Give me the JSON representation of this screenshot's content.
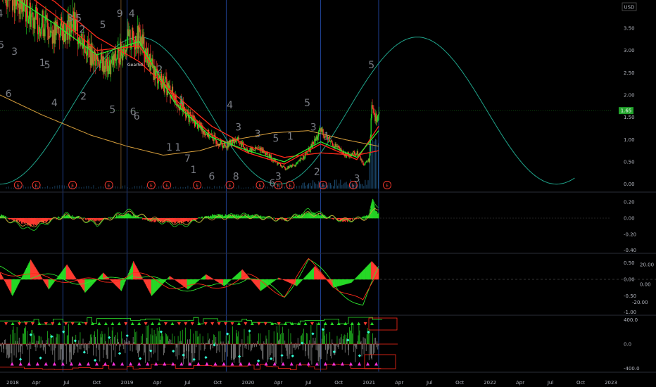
{
  "currency_label": "USD",
  "last_price_label": "1.65",
  "annotation_label": "Gearhd",
  "colors": {
    "background": "#000000",
    "up": "#26d926",
    "down": "#ff3b30",
    "sine": "#1fa38a",
    "ma_orange": "#d9a03c",
    "ma_red": "#ff2a1a",
    "ma_green": "#2ee82e",
    "earnings": "#ff3b30",
    "cyan": "#33ffd6",
    "magenta": "#ff33dd",
    "vline_blue": "#1f3f8f",
    "vline_orange": "#6b4a22",
    "axis_text": "#b2b5be",
    "price_badge": "#21a32b"
  },
  "chart_data": [
    {
      "type": "line",
      "pane": "price",
      "title": "",
      "y_ticks": [
        "3.50",
        "3.00",
        "2.50",
        "2.00",
        "1.50",
        "1.00",
        "0.50",
        "0.00"
      ],
      "ylim": [
        -0.1,
        4.1
      ],
      "x_labels": [
        "2018",
        "Apr",
        "Jul",
        "Oct",
        "2019",
        "Apr",
        "Jul",
        "Oct",
        "2020",
        "Apr",
        "Jul",
        "Oct",
        "2021",
        "Apr",
        "Jul",
        "Oct",
        "2022",
        "Apr",
        "Jul",
        "Oct",
        "2023"
      ],
      "series": [
        {
          "values": [
            [
              2017.95,
              4.5
            ],
            [
              2018.1,
              4.1
            ],
            [
              2018.25,
              3.7
            ],
            [
              2018.4,
              3.4
            ],
            [
              2018.55,
              3.6
            ],
            [
              2018.7,
              2.9
            ],
            [
              2018.85,
              2.6
            ],
            [
              2019.0,
              3.2
            ],
            [
              2019.1,
              3.3
            ],
            [
              2019.2,
              2.6
            ],
            [
              2019.35,
              2.1
            ],
            [
              2019.5,
              1.55
            ],
            [
              2019.65,
              1.15
            ],
            [
              2019.8,
              0.85
            ],
            [
              2019.9,
              1.0
            ],
            [
              2020.0,
              0.75
            ],
            [
              2020.1,
              0.8
            ],
            [
              2020.2,
              0.55
            ],
            [
              2020.3,
              0.35
            ],
            [
              2020.4,
              0.45
            ],
            [
              2020.5,
              0.75
            ],
            [
              2020.6,
              1.2
            ],
            [
              2020.7,
              0.9
            ],
            [
              2020.8,
              0.65
            ],
            [
              2020.9,
              0.7
            ],
            [
              2020.95,
              0.45
            ],
            [
              2021.0,
              0.55
            ],
            [
              2021.02,
              1.75
            ],
            [
              2021.05,
              1.45
            ],
            [
              2021.08,
              1.65
            ]
          ]
        },
        {
          "values": [
            [
              2017.95,
              2.0
            ],
            [
              2018.3,
              1.55
            ],
            [
              2018.7,
              1.1
            ],
            [
              2019.0,
              0.85
            ],
            [
              2019.3,
              0.65
            ],
            [
              2019.6,
              0.75
            ],
            [
              2019.9,
              1.0
            ],
            [
              2020.2,
              1.15
            ],
            [
              2020.5,
              1.2
            ],
            [
              2020.8,
              1.0
            ],
            [
              2021.08,
              0.85
            ]
          ]
        },
        {
          "values": [
            [
              2018.0,
              4.8
            ],
            [
              2018.4,
              4.1
            ],
            [
              2018.75,
              3.3
            ],
            [
              2019.1,
              2.75
            ],
            [
              2019.4,
              2.0
            ],
            [
              2019.7,
              1.3
            ],
            [
              2020.0,
              0.85
            ],
            [
              2020.3,
              0.6
            ],
            [
              2020.6,
              0.7
            ],
            [
              2020.9,
              0.65
            ],
            [
              2021.08,
              0.75
            ]
          ]
        },
        {
          "values": [
            [
              2018.0,
              4.6
            ],
            [
              2018.4,
              3.8
            ],
            [
              2018.75,
              3.0
            ],
            [
              2019.1,
              3.1
            ],
            [
              2019.4,
              1.9
            ],
            [
              2019.7,
              1.1
            ],
            [
              2020.0,
              0.7
            ],
            [
              2020.3,
              0.45
            ],
            [
              2020.6,
              0.9
            ],
            [
              2020.9,
              0.55
            ],
            [
              2021.08,
              1.3
            ]
          ]
        },
        {
          "values": [
            [
              2018.0,
              4.3
            ],
            [
              2018.4,
              3.6
            ],
            [
              2018.75,
              2.9
            ],
            [
              2019.1,
              3.2
            ],
            [
              2019.4,
              1.8
            ],
            [
              2019.7,
              1.05
            ],
            [
              2020.0,
              0.75
            ],
            [
              2020.3,
              0.5
            ],
            [
              2020.6,
              0.95
            ],
            [
              2020.9,
              0.6
            ],
            [
              2021.08,
              1.2
            ]
          ]
        }
      ],
      "sine_wave": {
        "min": 0.0,
        "max": 3.3,
        "peak_dates": [
          2019.1,
          2021.4
        ],
        "trough_dates": [
          2017.95,
          2020.25,
          2022.5
        ]
      },
      "earnings_marker_dates": [
        2018.1,
        2018.25,
        2018.55,
        2018.85,
        2019.2,
        2019.33,
        2019.58,
        2019.85,
        2020.1,
        2020.25,
        2020.35,
        2020.62,
        2020.87,
        2021.15
      ],
      "elliott_labels": [
        {
          "text": "4",
          "x": 2017.95,
          "y": 3.75
        },
        {
          "text": "5",
          "x": 2017.96,
          "y": 3.05
        },
        {
          "text": "3",
          "x": 2018.07,
          "y": 2.9
        },
        {
          "text": "6",
          "x": 2018.02,
          "y": 1.95
        },
        {
          "text": "1",
          "x": 2018.3,
          "y": 2.65
        },
        {
          "text": "5",
          "x": 2018.34,
          "y": 2.6
        },
        {
          "text": "4",
          "x": 2018.4,
          "y": 1.75
        },
        {
          "text": "3",
          "x": 2018.53,
          "y": 3.65
        },
        {
          "text": "5",
          "x": 2018.6,
          "y": 3.65
        },
        {
          "text": "2",
          "x": 2018.63,
          "y": 3.4
        },
        {
          "text": "5",
          "x": 2018.8,
          "y": 3.5
        },
        {
          "text": "2",
          "x": 2018.64,
          "y": 1.9
        },
        {
          "text": "9",
          "x": 2018.94,
          "y": 3.75
        },
        {
          "text": "4",
          "x": 2019.04,
          "y": 3.75
        },
        {
          "text": "5",
          "x": 2018.88,
          "y": 1.6
        },
        {
          "text": "6",
          "x": 2019.05,
          "y": 1.55
        },
        {
          "text": "6",
          "x": 2019.08,
          "y": 1.45
        },
        {
          "text": "2",
          "x": 2019.27,
          "y": 2.5
        },
        {
          "text": "1",
          "x": 2019.45,
          "y": 1.8
        },
        {
          "text": "1",
          "x": 2019.35,
          "y": 0.75
        },
        {
          "text": "1",
          "x": 2019.42,
          "y": 0.75
        },
        {
          "text": "7",
          "x": 2019.5,
          "y": 0.5
        },
        {
          "text": "1",
          "x": 2019.55,
          "y": 0.25
        },
        {
          "text": "6",
          "x": 2019.7,
          "y": 0.1
        },
        {
          "text": "4",
          "x": 2019.85,
          "y": 1.7
        },
        {
          "text": "3",
          "x": 2019.92,
          "y": 1.2
        },
        {
          "text": "8",
          "x": 2019.9,
          "y": 0.1
        },
        {
          "text": "3",
          "x": 2020.08,
          "y": 1.05
        },
        {
          "text": "5",
          "x": 2020.23,
          "y": 0.95
        },
        {
          "text": "1",
          "x": 2020.35,
          "y": 1.0
        },
        {
          "text": "6",
          "x": 2020.2,
          "y": -0.05
        },
        {
          "text": "3",
          "x": 2020.25,
          "y": 0.1
        },
        {
          "text": "5",
          "x": 2020.49,
          "y": 1.75
        },
        {
          "text": "3",
          "x": 2020.54,
          "y": 1.2
        },
        {
          "text": "1",
          "x": 2020.65,
          "y": 1.0
        },
        {
          "text": "2",
          "x": 2020.57,
          "y": 0.2
        },
        {
          "text": "3",
          "x": 2020.9,
          "y": 0.05
        },
        {
          "text": "5",
          "x": 2021.02,
          "y": 2.6
        }
      ]
    },
    {
      "type": "area",
      "pane": "oscillator_1",
      "title": "",
      "y_ticks": [
        "0.20",
        "0.00",
        "-0.20",
        "-0.40"
      ],
      "ylim": [
        -0.42,
        0.28
      ],
      "series": [
        {
          "values": [
            [
              2017.95,
              0.02
            ],
            [
              2018.2,
              -0.15
            ],
            [
              2018.5,
              0.05
            ],
            [
              2018.75,
              -0.08
            ],
            [
              2019.0,
              0.1
            ],
            [
              2019.2,
              -0.02
            ],
            [
              2019.45,
              -0.1
            ],
            [
              2019.7,
              0.02
            ],
            [
              2020.0,
              0.04
            ],
            [
              2020.3,
              -0.03
            ],
            [
              2020.5,
              0.1
            ],
            [
              2020.8,
              -0.04
            ],
            [
              2021.0,
              0.02
            ],
            [
              2021.03,
              0.22
            ],
            [
              2021.08,
              0.15
            ]
          ]
        },
        {
          "values": [
            [
              2017.95,
              0.0
            ],
            [
              2018.2,
              -0.1
            ],
            [
              2018.5,
              0.03
            ],
            [
              2018.75,
              -0.06
            ],
            [
              2019.0,
              0.07
            ],
            [
              2019.2,
              0.0
            ],
            [
              2019.45,
              -0.07
            ],
            [
              2019.7,
              0.0
            ],
            [
              2020.0,
              0.02
            ],
            [
              2020.3,
              -0.02
            ],
            [
              2020.5,
              0.06
            ],
            [
              2020.8,
              -0.02
            ],
            [
              2021.0,
              0.0
            ],
            [
              2021.05,
              0.14
            ],
            [
              2021.08,
              0.12
            ]
          ]
        }
      ]
    },
    {
      "type": "area",
      "pane": "oscillator_2",
      "title": "",
      "y_ticks": [
        "0.50",
        "0.00",
        "-0.50",
        "-1.00"
      ],
      "y_ticks_right": [
        "20.00",
        "0.00",
        "-20.00"
      ],
      "ylim": [
        -1.05,
        0.75
      ],
      "series": [
        {
          "values": [
            [
              2017.95,
              0.2
            ],
            [
              2018.05,
              -0.5
            ],
            [
              2018.2,
              0.6
            ],
            [
              2018.35,
              -0.3
            ],
            [
              2018.5,
              0.45
            ],
            [
              2018.65,
              -0.4
            ],
            [
              2018.8,
              0.2
            ],
            [
              2018.95,
              -0.35
            ],
            [
              2019.05,
              0.55
            ],
            [
              2019.2,
              -0.5
            ],
            [
              2019.35,
              0.1
            ],
            [
              2019.5,
              -0.3
            ],
            [
              2019.65,
              0.15
            ],
            [
              2019.8,
              -0.2
            ],
            [
              2019.95,
              0.3
            ],
            [
              2020.1,
              -0.35
            ],
            [
              2020.25,
              0.05
            ],
            [
              2020.4,
              -0.2
            ],
            [
              2020.55,
              0.4
            ],
            [
              2020.7,
              -0.25
            ],
            [
              2020.85,
              -0.1
            ],
            [
              2021.02,
              0.55
            ],
            [
              2021.08,
              0.3
            ]
          ]
        },
        {
          "values": [
            [
              2017.95,
              0.3
            ],
            [
              2018.2,
              0.1
            ],
            [
              2018.5,
              0.0
            ],
            [
              2018.8,
              -0.1
            ],
            [
              2019.05,
              0.2
            ],
            [
              2019.35,
              -0.2
            ],
            [
              2019.7,
              -0.3
            ],
            [
              2020.0,
              0.1
            ],
            [
              2020.3,
              -0.5
            ],
            [
              2020.5,
              0.6
            ],
            [
              2020.75,
              -0.3
            ],
            [
              2020.95,
              -0.8
            ],
            [
              2021.08,
              0.3
            ]
          ]
        }
      ]
    },
    {
      "type": "bar",
      "pane": "indicator_3",
      "title": "",
      "y_ticks": [
        "400.0",
        "0.0",
        "-400.0"
      ],
      "ylim": [
        -450,
        450
      ]
    }
  ]
}
